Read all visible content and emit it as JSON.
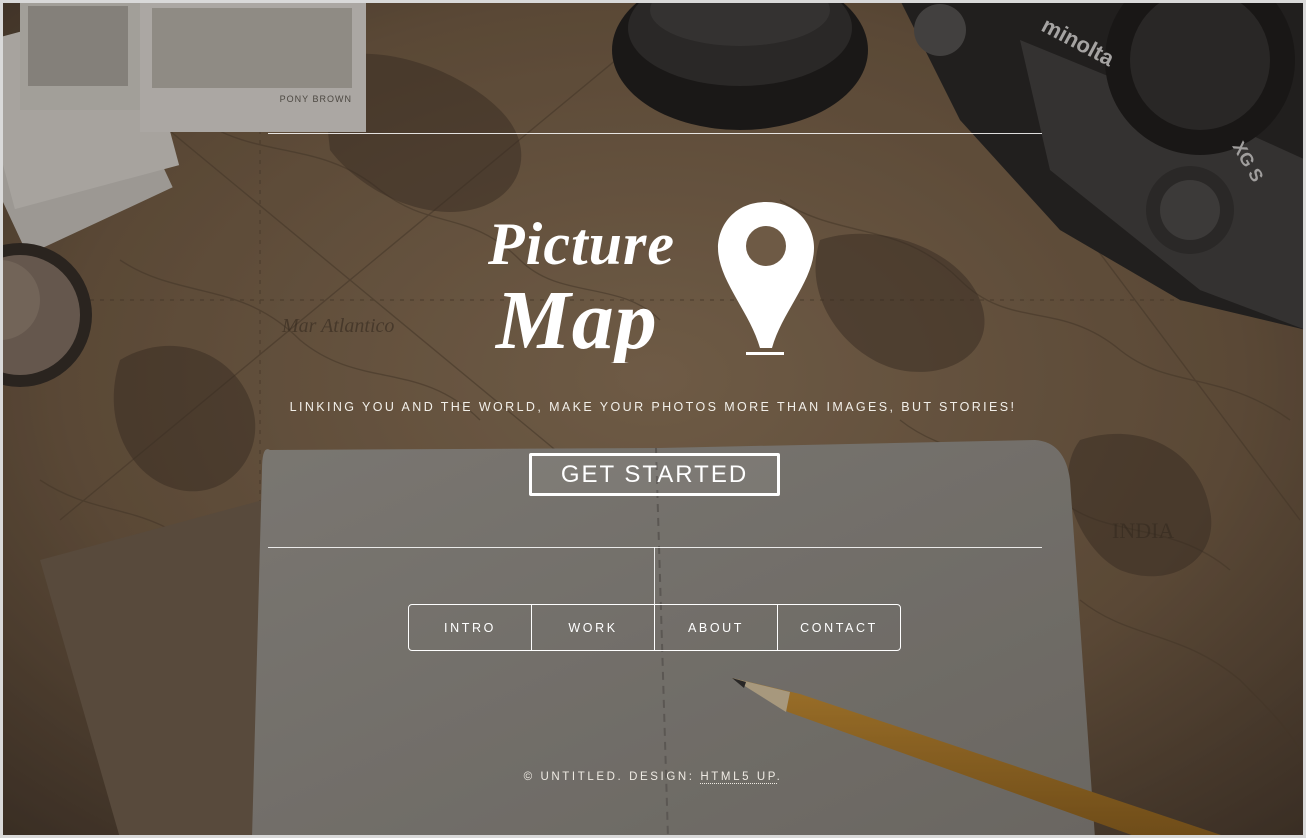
{
  "brand": {
    "logo_line1": "Picture",
    "logo_line2": "Map",
    "pin": "map-pin-icon"
  },
  "hero": {
    "tagline": "LINKING YOU AND THE WORLD, MAKE YOUR PHOTOS MORE THAN IMAGES, BUT STORIES!",
    "cta_label": "GET STARTED"
  },
  "nav": {
    "items": [
      {
        "label": "INTRO"
      },
      {
        "label": "WORK"
      },
      {
        "label": "ABOUT"
      },
      {
        "label": "CONTACT"
      }
    ]
  },
  "footer": {
    "copyright": "© UNTITLED. DESIGN: ",
    "credit_link": "HTML5 UP",
    "end": "."
  },
  "background_text": {
    "photo_caption": "PONY BROWN",
    "camera_brand": "minolta",
    "camera_model": "XG S",
    "map_label_atlantic": "Mar Atlantico",
    "map_label_india": "INDIA"
  },
  "colors": {
    "overlay": "#28221c",
    "map_paper": "#7a6349",
    "notebook": "#8c8a84",
    "text": "#ffffff"
  }
}
